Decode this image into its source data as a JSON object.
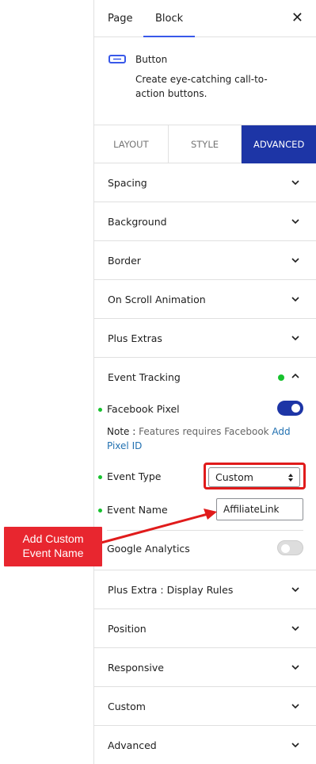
{
  "header": {
    "tabs": [
      {
        "label": "Page",
        "active": false
      },
      {
        "label": "Block",
        "active": true
      }
    ],
    "close_icon": "close-icon",
    "close_glyph": "✕"
  },
  "block": {
    "icon": "button-block-icon",
    "name": "Button",
    "description": "Create eye-catching call-to-action buttons."
  },
  "inspector_tabs": [
    {
      "label": "LAYOUT",
      "active": false
    },
    {
      "label": "STYLE",
      "active": false
    },
    {
      "label": "ADVANCED",
      "active": true
    }
  ],
  "panels_top": [
    {
      "label": "Spacing"
    },
    {
      "label": "Background"
    },
    {
      "label": "Border"
    },
    {
      "label": "On Scroll Animation"
    },
    {
      "label": "Plus Extras"
    }
  ],
  "event_tracking": {
    "label": "Event Tracking",
    "status_dot_color": "#17c22e",
    "facebook_pixel": {
      "label": "Facebook Pixel",
      "enabled": true
    },
    "note": {
      "key": "Note :",
      "text": " Features requires Facebook ",
      "link": "Add Pixel ID"
    },
    "event_type": {
      "label": "Event Type",
      "value": "Custom"
    },
    "event_name": {
      "label": "Event Name",
      "value": "AffiliateLink"
    },
    "google_analytics": {
      "label": "Google Analytics",
      "enabled": false
    }
  },
  "panels_bottom": [
    {
      "label": "Plus Extra : Display Rules"
    },
    {
      "label": "Position"
    },
    {
      "label": "Responsive"
    },
    {
      "label": "Custom"
    },
    {
      "label": "Advanced"
    }
  ],
  "annotation": {
    "callout_line1": "Add Custom",
    "callout_line2": "Event Name",
    "color": "#e8262f"
  },
  "colors": {
    "accent": "#1d35a6",
    "tab_indicator": "#3858e9",
    "link": "#2271b1"
  }
}
